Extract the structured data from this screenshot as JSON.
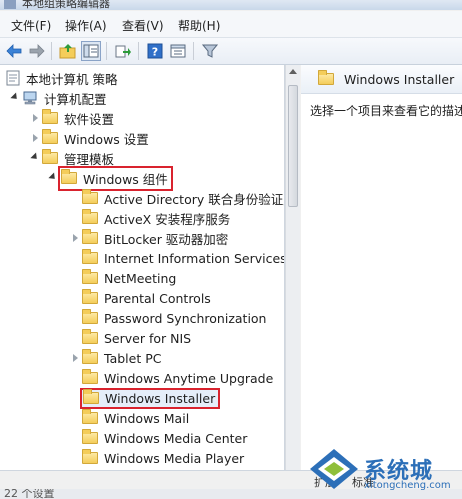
{
  "window": {
    "title": "本地组策略编辑器"
  },
  "menu": [
    "文件(F)",
    "操作(A)",
    "查看(V)",
    "帮助(H)"
  ],
  "toolbar": {
    "buttons": [
      "back-arrow-icon",
      "forward-arrow-icon",
      "folder-up-icon",
      "show-tree-icon",
      "export-icon",
      "help-icon",
      "properties-icon",
      "filter-icon"
    ]
  },
  "tree": {
    "items": [
      {
        "label": "本地计算机 策略",
        "indent": 0,
        "expander": "none",
        "icon": "policy"
      },
      {
        "label": "计算机配置",
        "indent": 1,
        "expander": "expanded",
        "icon": "computer"
      },
      {
        "label": "软件设置",
        "indent": 2,
        "expander": "collapsed",
        "icon": "folder"
      },
      {
        "label": "Windows 设置",
        "indent": 2,
        "expander": "collapsed",
        "icon": "folder"
      },
      {
        "label": "管理模板",
        "indent": 2,
        "expander": "expanded",
        "icon": "folder"
      },
      {
        "label": "Windows 组件",
        "indent": 3,
        "expander": "expanded",
        "icon": "folder",
        "highlighted": true
      },
      {
        "label": "Active Directory 联合身份验证服",
        "indent": 4,
        "expander": "none",
        "icon": "folder"
      },
      {
        "label": "ActiveX 安装程序服务",
        "indent": 4,
        "expander": "none",
        "icon": "folder"
      },
      {
        "label": "BitLocker 驱动器加密",
        "indent": 4,
        "expander": "collapsed",
        "icon": "folder"
      },
      {
        "label": "Internet Information Services",
        "indent": 4,
        "expander": "none",
        "icon": "folder"
      },
      {
        "label": "NetMeeting",
        "indent": 4,
        "expander": "none",
        "icon": "folder"
      },
      {
        "label": "Parental Controls",
        "indent": 4,
        "expander": "none",
        "icon": "folder"
      },
      {
        "label": "Password Synchronization",
        "indent": 4,
        "expander": "none",
        "icon": "folder"
      },
      {
        "label": "Server for NIS",
        "indent": 4,
        "expander": "none",
        "icon": "folder"
      },
      {
        "label": "Tablet PC",
        "indent": 4,
        "expander": "collapsed",
        "icon": "folder"
      },
      {
        "label": "Windows Anytime Upgrade",
        "indent": 4,
        "expander": "none",
        "icon": "folder"
      },
      {
        "label": "Windows Installer",
        "indent": 4,
        "expander": "none",
        "icon": "folder",
        "highlighted": true
      },
      {
        "label": "Windows Mail",
        "indent": 4,
        "expander": "none",
        "icon": "folder"
      },
      {
        "label": "Windows Media Center",
        "indent": 4,
        "expander": "none",
        "icon": "folder"
      },
      {
        "label": "Windows Media Player",
        "indent": 4,
        "expander": "none",
        "icon": "folder"
      }
    ]
  },
  "details": {
    "header_title": "Windows Installer",
    "description": "选择一个项目来查看它的描述。"
  },
  "bottom_tabs": [
    "扩展",
    "标准"
  ],
  "status": "22 个设置",
  "watermark": {
    "brand": "系统城",
    "url": "xitongcheng.com"
  },
  "colors": {
    "highlight_border": "#d9232e",
    "accent": "#2c6fb8"
  }
}
